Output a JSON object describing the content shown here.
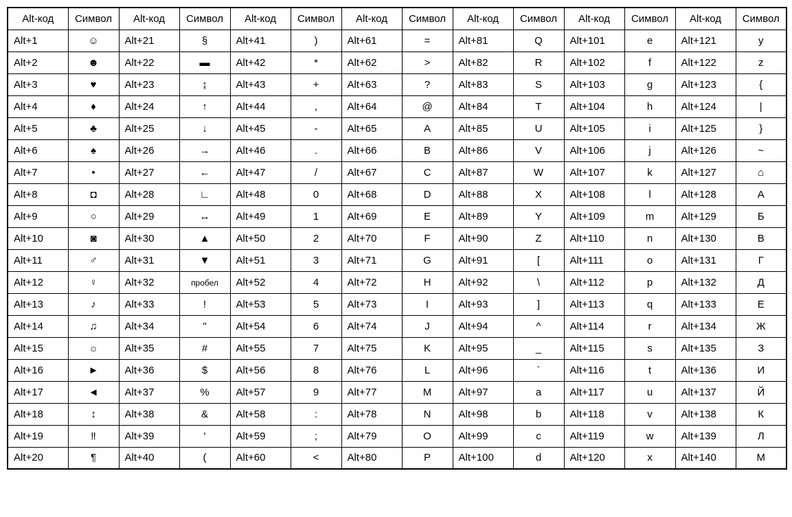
{
  "headers": {
    "code": "Alt-код",
    "symbol": "Символ"
  },
  "column_pairs": 7,
  "rows_per_column": 20,
  "entries": [
    {
      "code": "Alt+1",
      "symbol": "☺"
    },
    {
      "code": "Alt+2",
      "symbol": "☻"
    },
    {
      "code": "Alt+3",
      "symbol": "♥"
    },
    {
      "code": "Alt+4",
      "symbol": "♦"
    },
    {
      "code": "Alt+5",
      "symbol": "♣"
    },
    {
      "code": "Alt+6",
      "symbol": "♠"
    },
    {
      "code": "Alt+7",
      "symbol": "•"
    },
    {
      "code": "Alt+8",
      "symbol": "◘"
    },
    {
      "code": "Alt+9",
      "symbol": "○"
    },
    {
      "code": "Alt+10",
      "symbol": "◙"
    },
    {
      "code": "Alt+11",
      "symbol": "♂"
    },
    {
      "code": "Alt+12",
      "symbol": "♀"
    },
    {
      "code": "Alt+13",
      "symbol": "♪"
    },
    {
      "code": "Alt+14",
      "symbol": "♫"
    },
    {
      "code": "Alt+15",
      "symbol": "☼"
    },
    {
      "code": "Alt+16",
      "symbol": "►"
    },
    {
      "code": "Alt+17",
      "symbol": "◄"
    },
    {
      "code": "Alt+18",
      "symbol": "↕"
    },
    {
      "code": "Alt+19",
      "symbol": "‼"
    },
    {
      "code": "Alt+20",
      "symbol": "¶"
    },
    {
      "code": "Alt+21",
      "symbol": "§"
    },
    {
      "code": "Alt+22",
      "symbol": "▬"
    },
    {
      "code": "Alt+23",
      "symbol": "↨"
    },
    {
      "code": "Alt+24",
      "symbol": "↑"
    },
    {
      "code": "Alt+25",
      "symbol": "↓"
    },
    {
      "code": "Alt+26",
      "symbol": "→"
    },
    {
      "code": "Alt+27",
      "symbol": "←"
    },
    {
      "code": "Alt+28",
      "symbol": "∟"
    },
    {
      "code": "Alt+29",
      "symbol": "↔"
    },
    {
      "code": "Alt+30",
      "symbol": "▲"
    },
    {
      "code": "Alt+31",
      "symbol": "▼"
    },
    {
      "code": "Alt+32",
      "symbol": "пробел"
    },
    {
      "code": "Alt+33",
      "symbol": "!"
    },
    {
      "code": "Alt+34",
      "symbol": "\""
    },
    {
      "code": "Alt+35",
      "symbol": "#"
    },
    {
      "code": "Alt+36",
      "symbol": "$"
    },
    {
      "code": "Alt+37",
      "symbol": "%"
    },
    {
      "code": "Alt+38",
      "symbol": "&"
    },
    {
      "code": "Alt+39",
      "symbol": "'"
    },
    {
      "code": "Alt+40",
      "symbol": "("
    },
    {
      "code": "Alt+41",
      "symbol": ")"
    },
    {
      "code": "Alt+42",
      "symbol": "*"
    },
    {
      "code": "Alt+43",
      "symbol": "+"
    },
    {
      "code": "Alt+44",
      "symbol": ","
    },
    {
      "code": "Alt+45",
      "symbol": "-"
    },
    {
      "code": "Alt+46",
      "symbol": "."
    },
    {
      "code": "Alt+47",
      "symbol": "/"
    },
    {
      "code": "Alt+48",
      "symbol": "0"
    },
    {
      "code": "Alt+49",
      "symbol": "1"
    },
    {
      "code": "Alt+50",
      "symbol": "2"
    },
    {
      "code": "Alt+51",
      "symbol": "3"
    },
    {
      "code": "Alt+52",
      "symbol": "4"
    },
    {
      "code": "Alt+53",
      "symbol": "5"
    },
    {
      "code": "Alt+54",
      "symbol": "6"
    },
    {
      "code": "Alt+55",
      "symbol": "7"
    },
    {
      "code": "Alt+56",
      "symbol": "8"
    },
    {
      "code": "Alt+57",
      "symbol": "9"
    },
    {
      "code": "Alt+58",
      "symbol": ":"
    },
    {
      "code": "Alt+59",
      "symbol": ";"
    },
    {
      "code": "Alt+60",
      "symbol": "<"
    },
    {
      "code": "Alt+61",
      "symbol": "="
    },
    {
      "code": "Alt+62",
      "symbol": ">"
    },
    {
      "code": "Alt+63",
      "symbol": "?"
    },
    {
      "code": "Alt+64",
      "symbol": "@"
    },
    {
      "code": "Alt+65",
      "symbol": "A"
    },
    {
      "code": "Alt+66",
      "symbol": "B"
    },
    {
      "code": "Alt+67",
      "symbol": "C"
    },
    {
      "code": "Alt+68",
      "symbol": "D"
    },
    {
      "code": "Alt+69",
      "symbol": "E"
    },
    {
      "code": "Alt+70",
      "symbol": "F"
    },
    {
      "code": "Alt+71",
      "symbol": "G"
    },
    {
      "code": "Alt+72",
      "symbol": "H"
    },
    {
      "code": "Alt+73",
      "symbol": "I"
    },
    {
      "code": "Alt+74",
      "symbol": "J"
    },
    {
      "code": "Alt+75",
      "symbol": "K"
    },
    {
      "code": "Alt+76",
      "symbol": "L"
    },
    {
      "code": "Alt+77",
      "symbol": "M"
    },
    {
      "code": "Alt+78",
      "symbol": "N"
    },
    {
      "code": "Alt+79",
      "symbol": "O"
    },
    {
      "code": "Alt+80",
      "symbol": "P"
    },
    {
      "code": "Alt+81",
      "symbol": "Q"
    },
    {
      "code": "Alt+82",
      "symbol": "R"
    },
    {
      "code": "Alt+83",
      "symbol": "S"
    },
    {
      "code": "Alt+84",
      "symbol": "T"
    },
    {
      "code": "Alt+85",
      "symbol": "U"
    },
    {
      "code": "Alt+86",
      "symbol": "V"
    },
    {
      "code": "Alt+87",
      "symbol": "W"
    },
    {
      "code": "Alt+88",
      "symbol": "X"
    },
    {
      "code": "Alt+89",
      "symbol": "Y"
    },
    {
      "code": "Alt+90",
      "symbol": "Z"
    },
    {
      "code": "Alt+91",
      "symbol": "["
    },
    {
      "code": "Alt+92",
      "symbol": "\\"
    },
    {
      "code": "Alt+93",
      "symbol": "]"
    },
    {
      "code": "Alt+94",
      "symbol": "^"
    },
    {
      "code": "Alt+95",
      "symbol": "_"
    },
    {
      "code": "Alt+96",
      "symbol": "`"
    },
    {
      "code": "Alt+97",
      "symbol": "a"
    },
    {
      "code": "Alt+98",
      "symbol": "b"
    },
    {
      "code": "Alt+99",
      "symbol": "c"
    },
    {
      "code": "Alt+100",
      "symbol": "d"
    },
    {
      "code": "Alt+101",
      "symbol": "e"
    },
    {
      "code": "Alt+102",
      "symbol": "f"
    },
    {
      "code": "Alt+103",
      "symbol": "g"
    },
    {
      "code": "Alt+104",
      "symbol": "h"
    },
    {
      "code": "Alt+105",
      "symbol": "i"
    },
    {
      "code": "Alt+106",
      "symbol": "j"
    },
    {
      "code": "Alt+107",
      "symbol": "k"
    },
    {
      "code": "Alt+108",
      "symbol": "l"
    },
    {
      "code": "Alt+109",
      "symbol": "m"
    },
    {
      "code": "Alt+110",
      "symbol": "n"
    },
    {
      "code": "Alt+111",
      "symbol": "o"
    },
    {
      "code": "Alt+112",
      "symbol": "p"
    },
    {
      "code": "Alt+113",
      "symbol": "q"
    },
    {
      "code": "Alt+114",
      "symbol": "r"
    },
    {
      "code": "Alt+115",
      "symbol": "s"
    },
    {
      "code": "Alt+116",
      "symbol": "t"
    },
    {
      "code": "Alt+117",
      "symbol": "u"
    },
    {
      "code": "Alt+118",
      "symbol": "v"
    },
    {
      "code": "Alt+119",
      "symbol": "w"
    },
    {
      "code": "Alt+120",
      "symbol": "x"
    },
    {
      "code": "Alt+121",
      "symbol": "y"
    },
    {
      "code": "Alt+122",
      "symbol": "z"
    },
    {
      "code": "Alt+123",
      "symbol": "{"
    },
    {
      "code": "Alt+124",
      "symbol": "|"
    },
    {
      "code": "Alt+125",
      "symbol": "}"
    },
    {
      "code": "Alt+126",
      "symbol": "~"
    },
    {
      "code": "Alt+127",
      "symbol": "⌂"
    },
    {
      "code": "Alt+128",
      "symbol": "А"
    },
    {
      "code": "Alt+129",
      "symbol": "Б"
    },
    {
      "code": "Alt+130",
      "symbol": "В"
    },
    {
      "code": "Alt+131",
      "symbol": "Г"
    },
    {
      "code": "Alt+132",
      "symbol": "Д"
    },
    {
      "code": "Alt+133",
      "symbol": "Е"
    },
    {
      "code": "Alt+134",
      "symbol": "Ж"
    },
    {
      "code": "Alt+135",
      "symbol": "З"
    },
    {
      "code": "Alt+136",
      "symbol": "И"
    },
    {
      "code": "Alt+137",
      "symbol": "Й"
    },
    {
      "code": "Alt+138",
      "symbol": "К"
    },
    {
      "code": "Alt+139",
      "symbol": "Л"
    },
    {
      "code": "Alt+140",
      "symbol": "М"
    }
  ]
}
